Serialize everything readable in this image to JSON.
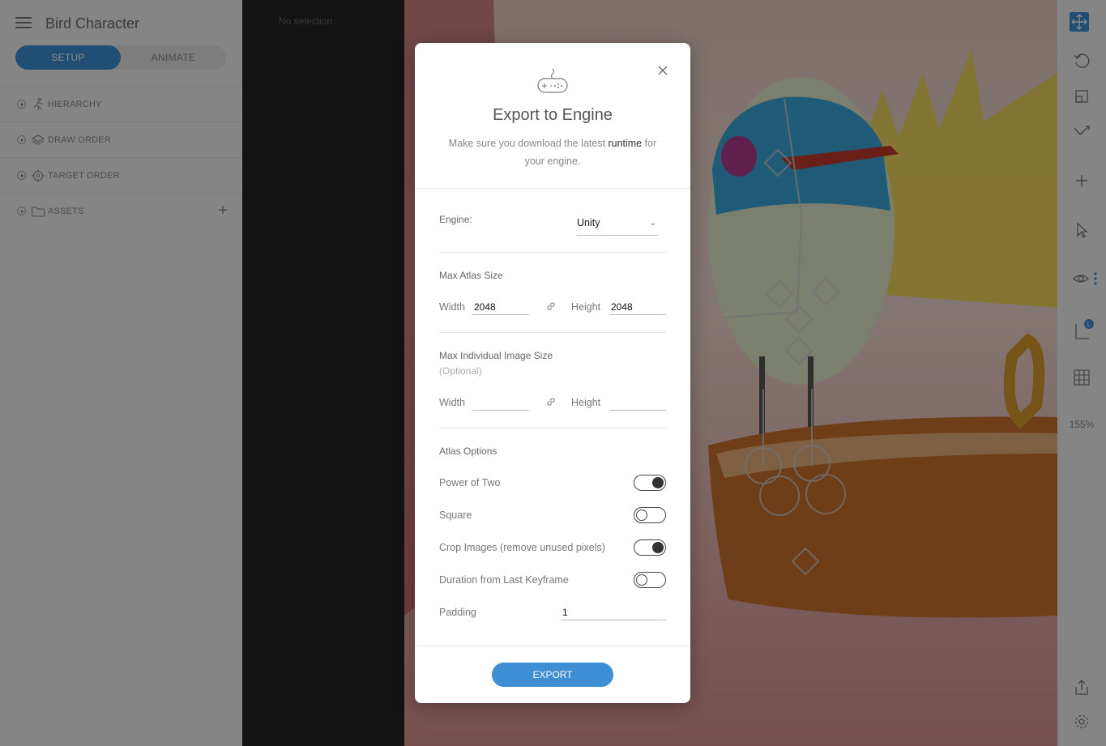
{
  "app": {
    "document_title": "Bird Character",
    "modes": {
      "setup": "SETUP",
      "animate": "ANIMATE",
      "active": "SETUP"
    }
  },
  "sidebar": {
    "sections": [
      {
        "label": "HIERARCHY",
        "icon": "running-figure-icon"
      },
      {
        "label": "DRAW ORDER",
        "icon": "layers-icon"
      },
      {
        "label": "TARGET ORDER",
        "icon": "target-icon"
      },
      {
        "label": "ASSETS",
        "icon": "folder-icon"
      }
    ],
    "assets_add": "+"
  },
  "inspector": {
    "empty_text": "No selection"
  },
  "toolbar": {
    "tools": [
      "translate-icon",
      "rotate-icon",
      "scale-icon",
      "bones-icon",
      "add-icon",
      "select-icon",
      "visibility-icon",
      "axis-icon",
      "grid-icon"
    ],
    "axis_badge": "L",
    "zoom": "155%",
    "bottom_tools": [
      "share-icon",
      "settings-icon"
    ]
  },
  "modal": {
    "title": "Export to Engine",
    "desc_before": "Make sure you download the latest ",
    "desc_link": "runtime",
    "desc_after": " for your engine.",
    "engine_label": "Engine:",
    "engine_value": "Unity",
    "max_atlas": {
      "title": "Max Atlas Size",
      "width_label": "Width",
      "width_value": "2048",
      "height_label": "Height",
      "height_value": "2048"
    },
    "max_image": {
      "title": "Max Individual Image Size",
      "subtitle": "(Optional)",
      "width_label": "Width",
      "width_value": "",
      "height_label": "Height",
      "height_value": ""
    },
    "atlas_options": {
      "title": "Atlas Options",
      "options": [
        {
          "label": "Power of Two",
          "on": true
        },
        {
          "label": "Square",
          "on": false
        },
        {
          "label": "Crop Images (remove unused pixels)",
          "on": true
        },
        {
          "label": "Duration from Last Keyframe",
          "on": false
        }
      ],
      "padding_label": "Padding",
      "padding_value": "1"
    },
    "export_label": "EXPORT"
  },
  "colors": {
    "accent": "#3d8ed3",
    "sidebar_bg": "#f3f3f3",
    "inspector_bg": "#232323"
  }
}
